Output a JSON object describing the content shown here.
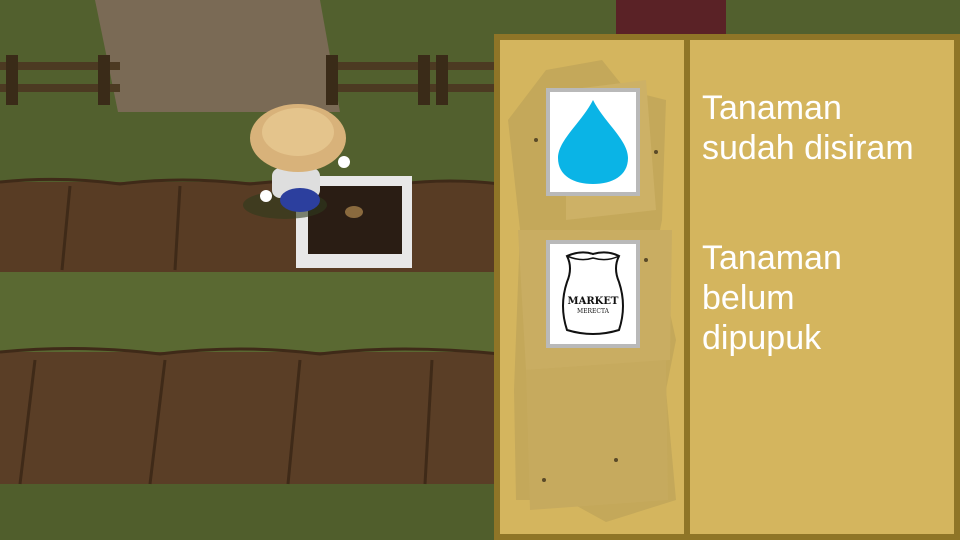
{
  "status_panel": {
    "water": {
      "icon": "water-drop-icon",
      "text": "Tanaman\nsudah disiram"
    },
    "fertilizer": {
      "icon": "fertilizer-sack-icon",
      "sack_label_main": "MARKET",
      "sack_label_sub": "MERECTA",
      "text": "Tanaman\nbelum\ndipupuk"
    }
  },
  "colors": {
    "water_drop": "#0ab4e6",
    "panel_fill": "#d4b55e",
    "panel_border": "#8f7527",
    "text": "#ffffff"
  }
}
